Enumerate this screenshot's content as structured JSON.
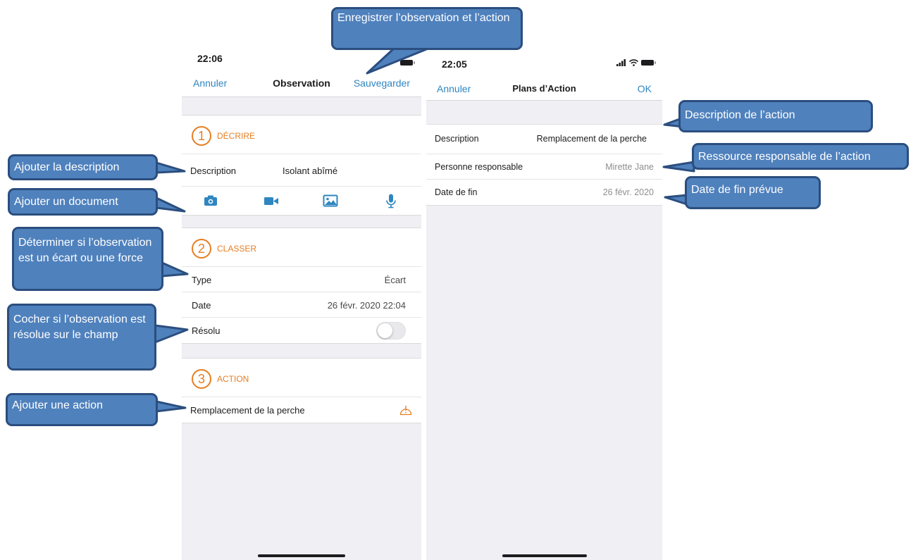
{
  "left_screen": {
    "status_time": "22:06",
    "nav": {
      "cancel": "Annuler",
      "title": "Observation",
      "save": "Sauvegarder"
    },
    "describe": {
      "step": "1",
      "title": "DÉCRIRE",
      "description_label": "Description",
      "description_value": "Isolant abîmé",
      "media_icons": [
        "camera-icon",
        "video-icon",
        "image-icon",
        "microphone-icon"
      ]
    },
    "classify": {
      "step": "2",
      "title": "CLASSER",
      "type_label": "Type",
      "type_value": "Écart",
      "date_label": "Date",
      "date_value": "26 févr. 2020 22:04",
      "resolved_label": "Résolu",
      "resolved_on": false
    },
    "action": {
      "step": "3",
      "title": "ACTION",
      "item_label": "Remplacement de la perche",
      "item_icon": "warning-icon"
    }
  },
  "right_screen": {
    "status_time": "22:05",
    "nav": {
      "cancel": "Annuler",
      "title": "Plans d’Action",
      "ok": "OK"
    },
    "rows": [
      {
        "label": "Description",
        "value": "Remplacement de la perche"
      },
      {
        "label": "Personne responsable",
        "value": "Mirette Jane"
      },
      {
        "label": "Date de fin",
        "value": "26 févr. 2020"
      }
    ]
  },
  "callouts": {
    "save": "Enregistrer l’observation et l’action",
    "add_description": "Ajouter la description",
    "add_document": "Ajouter un document",
    "classify": "Déterminer si l’observation est un écart ou une force",
    "resolved": "Cocher si l’observation est résolue sur le champ",
    "add_action": "Ajouter une action",
    "action_description": "Description  de l’action",
    "responsible": "Ressource responsable de l’action",
    "end_date": "Date de fin prévue"
  },
  "colors": {
    "accent_blue": "#2e86c1",
    "accent_orange": "#e67e22",
    "callout_fill": "#4f81bd",
    "callout_border": "#2b4e7e"
  }
}
